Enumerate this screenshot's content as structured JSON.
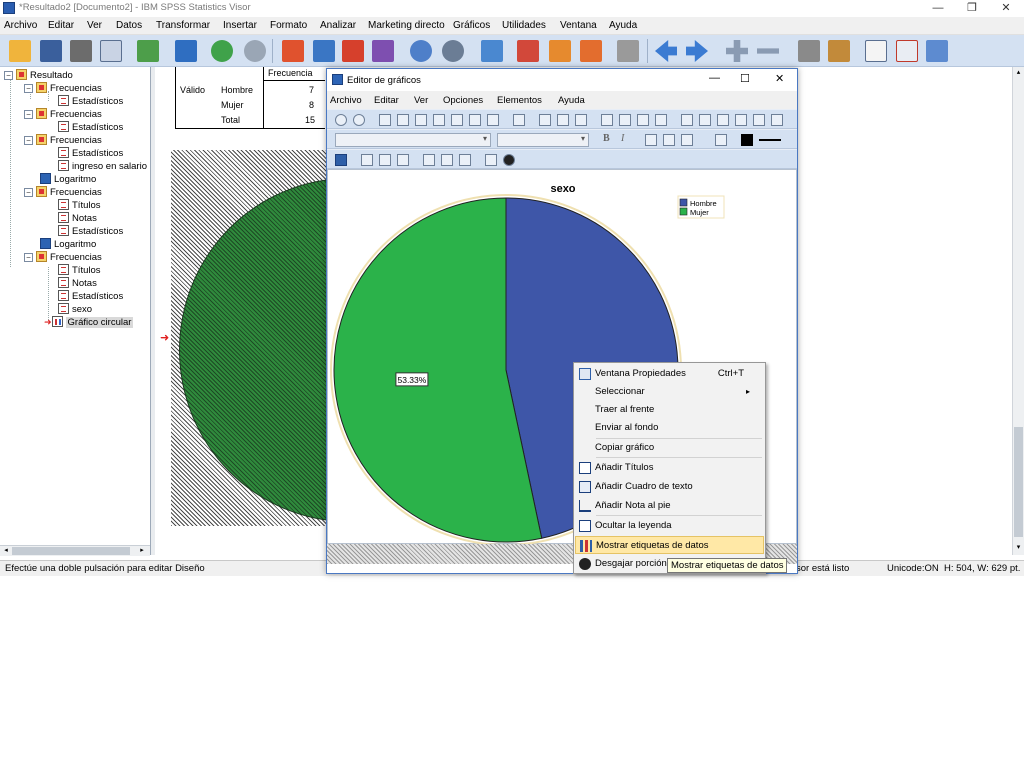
{
  "window": {
    "title": "*Resultado2 [Documento2] - IBM SPSS Statistics Visor",
    "controls": {
      "minimize": "—",
      "restore": "❐",
      "close": "✕"
    }
  },
  "menubar": [
    "Archivo",
    "Editar",
    "Ver",
    "Datos",
    "Transformar",
    "Insertar",
    "Formato",
    "Analizar",
    "Marketing directo",
    "Gráficos",
    "Utilidades",
    "Ventana",
    "Ayuda"
  ],
  "tree": {
    "nodes": [
      {
        "label": "Resultado"
      },
      {
        "label": "Frecuencias"
      },
      {
        "label": "Estadísticos"
      },
      {
        "label": "Frecuencias"
      },
      {
        "label": "Estadísticos"
      },
      {
        "label": "Frecuencias"
      },
      {
        "label": "Estadísticos"
      },
      {
        "label": "ingreso en salario"
      },
      {
        "label": "Logaritmo"
      },
      {
        "label": "Frecuencias"
      },
      {
        "label": "Títulos"
      },
      {
        "label": "Notas"
      },
      {
        "label": "Estadísticos"
      },
      {
        "label": "Logaritmo"
      },
      {
        "label": "Frecuencias"
      },
      {
        "label": "Títulos"
      },
      {
        "label": "Notas"
      },
      {
        "label": "Estadísticos"
      },
      {
        "label": "sexo"
      },
      {
        "label": "Gráfico circular"
      }
    ]
  },
  "freq_table": {
    "header": "Frecuencia",
    "group_label": "Válido",
    "rows": [
      {
        "label": "Hombre",
        "value": "7"
      },
      {
        "label": "Mujer",
        "value": "8"
      },
      {
        "label": "Total",
        "value": "15"
      }
    ]
  },
  "editor": {
    "title": "Editor de gráficos",
    "menubar": [
      "Archivo",
      "Editar",
      "Ver",
      "Opciones",
      "Elementos",
      "Ayuda"
    ],
    "font_buttons": {
      "bold": "B",
      "italic": "I"
    },
    "chart_data": {
      "type": "pie",
      "title": "sexo",
      "categories": [
        "Hombre",
        "Mujer"
      ],
      "values": [
        46.67,
        53.33
      ],
      "colors": [
        "#3e56a8",
        "#2bb24a"
      ],
      "data_labels": [
        "53.33%"
      ],
      "legend_position": "top-right"
    }
  },
  "context_menu": {
    "items": [
      {
        "label": "Ventana Propiedades",
        "shortcut": "Ctrl+T"
      },
      {
        "label": "Seleccionar",
        "submenu": "▸"
      },
      {
        "label": "Traer al frente"
      },
      {
        "label": "Enviar al fondo"
      },
      {
        "label": "Copiar gráfico"
      },
      {
        "label": "Añadir Títulos"
      },
      {
        "label": "Añadir Cuadro de texto"
      },
      {
        "label": "Añadir Nota al pie"
      },
      {
        "label": "Ocultar la leyenda"
      },
      {
        "label": "Mostrar etiquetas de datos"
      },
      {
        "label": "Desgajar porción"
      }
    ]
  },
  "tooltip": "Mostrar etiquetas de datos",
  "statusbar": {
    "left": "Efectúe una doble pulsación para editar Diseño",
    "processor": "sor está listo",
    "unicode": "Unicode:ON",
    "size": "H: 504, W: 629 pt."
  }
}
